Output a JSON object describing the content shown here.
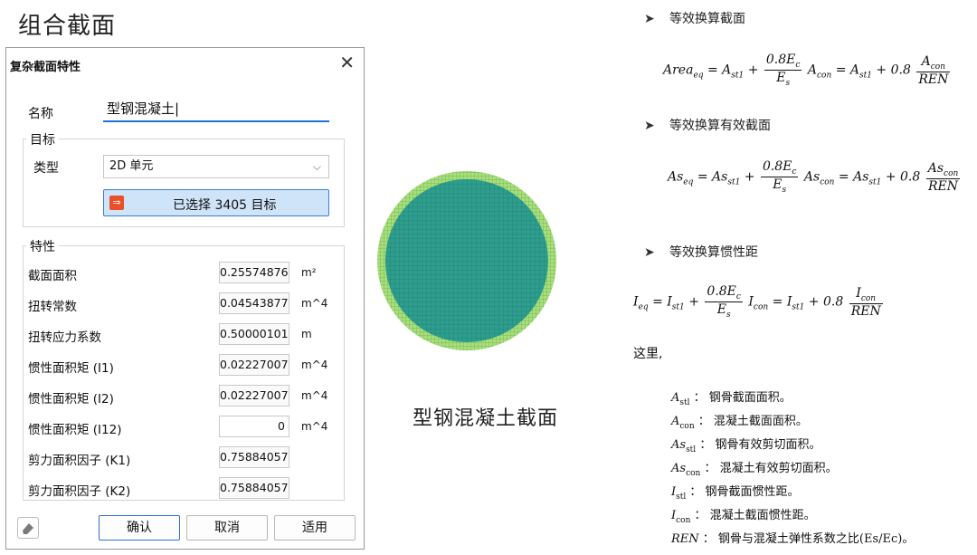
{
  "page_title": "组合截面",
  "dialog": {
    "title": "复杂截面特性",
    "name_label": "名称",
    "name_value": "型钢混凝土|",
    "target_group": "目标",
    "type_label": "类型",
    "type_value": "2D 单元",
    "select_button": "已选择 3405 目标",
    "props_group": "特性",
    "props": [
      {
        "label": "截面面积",
        "value": "0.25574876",
        "unit": "m²"
      },
      {
        "label": "扭转常数",
        "value": "0.04543877",
        "unit": "m^4"
      },
      {
        "label": "扭转应力系数",
        "value": "0.50000101",
        "unit": "m"
      },
      {
        "label": "惯性面积矩 (I1)",
        "value": "0.02227007",
        "unit": "m^4"
      },
      {
        "label": "惯性面积矩 (I2)",
        "value": "0.02227007",
        "unit": "m^4"
      },
      {
        "label": "惯性面积矩 (I12)",
        "value": "0",
        "unit": "m^4"
      },
      {
        "label": "剪力面积因子 (K1)",
        "value": "0.75884057",
        "unit": ""
      },
      {
        "label": "剪力面积因子 (K2)",
        "value": "0.75884057",
        "unit": ""
      }
    ],
    "ok_label": "确认",
    "cancel_label": "取消",
    "apply_label": "适用"
  },
  "caption": "型钢混凝土截面",
  "doc": {
    "b1": "等效换算截面",
    "b2": "等效换算有效截面",
    "b3": "等效换算惯性距",
    "intro": "这里,",
    "defs": [
      {
        "sym": "A",
        "sub": "stl",
        "text": "钢骨截面面积。"
      },
      {
        "sym": "A",
        "sub": "con",
        "text": "混凝土截面面积。"
      },
      {
        "sym": "As",
        "sub": "stl",
        "text": "钢骨有效剪切面积。"
      },
      {
        "sym": "As",
        "sub": "con",
        "text": "混凝土有效剪切面积。"
      },
      {
        "sym": "I",
        "sub": "stl",
        "text": "钢骨截面惯性距。"
      },
      {
        "sym": "I",
        "sub": "con",
        "text": "混凝土截面惯性距。"
      },
      {
        "sym": "REN",
        "sub": "",
        "text": "钢骨与混凝土弹性系数之比(Es/Ec)。"
      }
    ]
  },
  "colors": {
    "ring_outer": "#a6e07a",
    "core": "#2d9e8e",
    "mesh": "#1c5e57"
  }
}
